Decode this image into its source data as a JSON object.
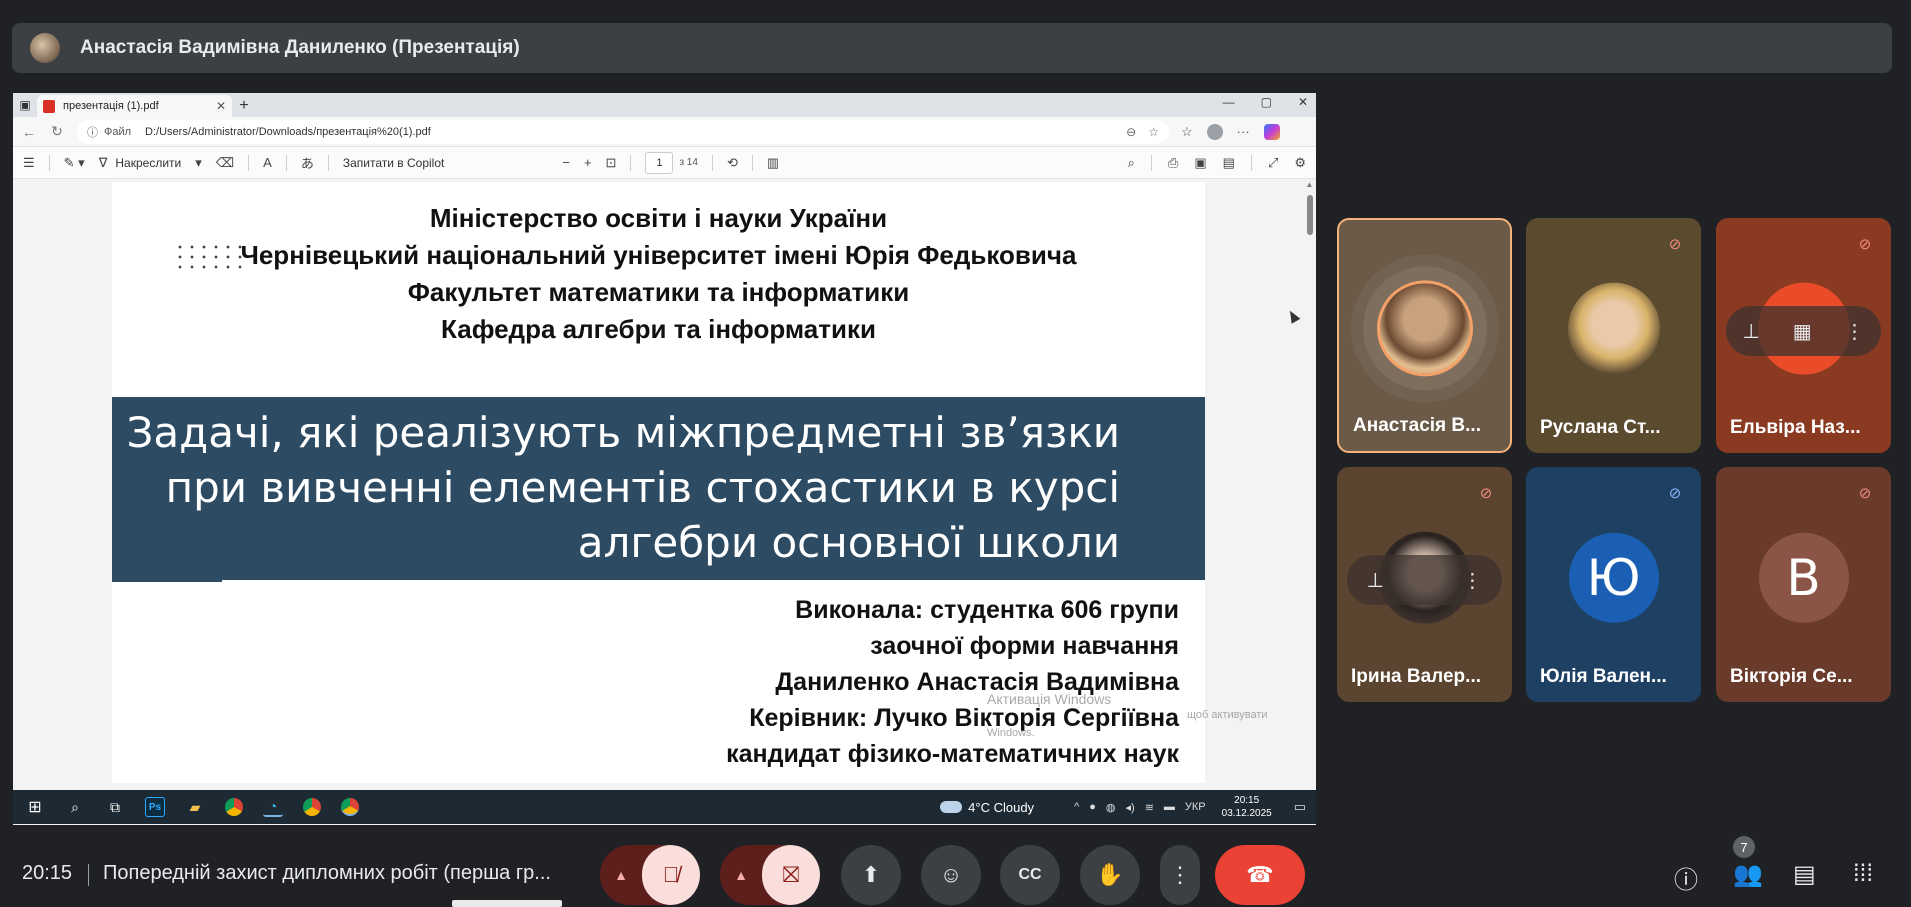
{
  "presenter": {
    "name": "Анастасія Вадимівна Даниленко (Презентація)"
  },
  "browser": {
    "tab_title": "презентація (1).pdf",
    "tab_close": "✕",
    "new_tab": "+",
    "url_scheme": "Файл",
    "url": "D:/Users/Administrator/Downloads/презентація%20(1).pdf"
  },
  "pdf_toolbar": {
    "draw_label": "Накреслити",
    "copilot_label": "Запитати в Copilot",
    "zoom_out": "−",
    "zoom_in": "+",
    "page_current": "1",
    "page_total": "з 14"
  },
  "slide": {
    "header": [
      "Міністерство освіти і науки України",
      "Чернівецький національний університет імені Юрія Федьковича",
      "Факультет математики та інформатики",
      "Кафедра алгебри та інформатики"
    ],
    "title": [
      "Задачі, які реалізують міжпредметні зв’язки",
      "при вивченні елементів стохастики в курсі",
      "алгебри основної школи"
    ],
    "author": [
      "Виконала: студентка 606 групи",
      "заочної форми навчання",
      "Даниленко Анастасія Вадимівна",
      "Керівник: Лучко Вікторія Сергіївна",
      "кандидат фізико-математичних наук"
    ]
  },
  "watermark": {
    "line1": "Активація Windows",
    "line2": "щоб активувати",
    "line3": "Windows."
  },
  "taskbar": {
    "ps_label": "Ps",
    "weather": "4°C  Cloudy",
    "lang": "УКР",
    "time": "20:15",
    "date": "03.12.2025"
  },
  "participants": [
    {
      "name": "Анастасія В...",
      "bg": "#6b5a48",
      "muted": false,
      "avatar": "photo"
    },
    {
      "name": "Руслана Ст...",
      "bg": "#5a4a2e",
      "muted": true,
      "avatar": "photo"
    },
    {
      "name": "Ельвіра Наз...",
      "bg": "#8b3a22",
      "muted": true,
      "avatar": "photo"
    },
    {
      "name": "Ірина Валер...",
      "bg": "#5b4430",
      "muted": true,
      "avatar": "photo"
    },
    {
      "name": "Юлія Вален...",
      "bg": "#1e4163",
      "muted": true,
      "avatar": "letter",
      "letter": "Ю"
    },
    {
      "name": "Вікторія Се...",
      "bg": "#6a3a2a",
      "muted": true,
      "avatar": "letter",
      "letter": "В"
    }
  ],
  "meeting": {
    "time": "20:15",
    "title": "Попередній захист дипломних робіт (перша гр...",
    "people_count": "7"
  },
  "colors": {
    "banner": "#2d4b63",
    "end_call": "#ea4335",
    "speaking_border": "#f6b27a"
  }
}
